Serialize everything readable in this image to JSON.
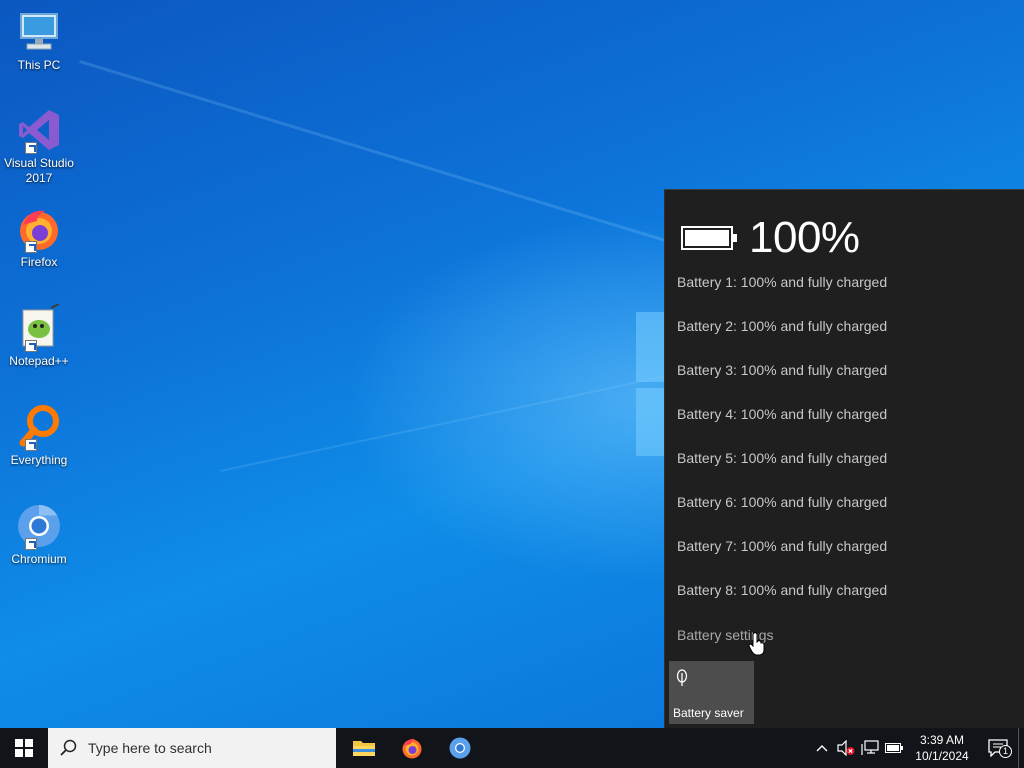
{
  "desktop": {
    "icons": [
      {
        "label": "This PC",
        "icon": "this-pc-icon"
      },
      {
        "label": "Visual Studio 2017",
        "icon": "visual-studio-icon"
      },
      {
        "label": "Firefox",
        "icon": "firefox-icon"
      },
      {
        "label": "Notepad++",
        "icon": "notepadpp-icon"
      },
      {
        "label": "Everything",
        "icon": "everything-icon"
      },
      {
        "label": "Chromium",
        "icon": "chromium-icon"
      }
    ]
  },
  "battery_flyout": {
    "percentage": "100%",
    "charge_level": 1.0,
    "batteries": [
      "Battery 1: 100% and fully charged",
      "Battery 2: 100% and fully charged",
      "Battery 3: 100% and fully charged",
      "Battery 4: 100% and fully charged",
      "Battery 5: 100% and fully charged",
      "Battery 6: 100% and fully charged",
      "Battery 7: 100% and fully charged",
      "Battery 8: 100% and fully charged"
    ],
    "settings_link": "Battery settings",
    "battery_saver_tile": {
      "label": "Battery saver",
      "state": "off"
    }
  },
  "taskbar": {
    "search_placeholder": "Type here to search",
    "pinned_apps": [
      "file-explorer-icon",
      "firefox-icon",
      "chromium-icon"
    ],
    "tray": {
      "time": "3:39 AM",
      "date": "10/1/2024",
      "notification_count": "1",
      "icons": [
        "chevron-up-icon",
        "volume-muted-icon",
        "network-icon",
        "battery-icon"
      ]
    }
  },
  "colors": {
    "flyout_bg": "#1f1f1f",
    "tile_bg": "#4d4d4d",
    "taskbar_bg": "#111418",
    "accent": "#0078d7"
  }
}
